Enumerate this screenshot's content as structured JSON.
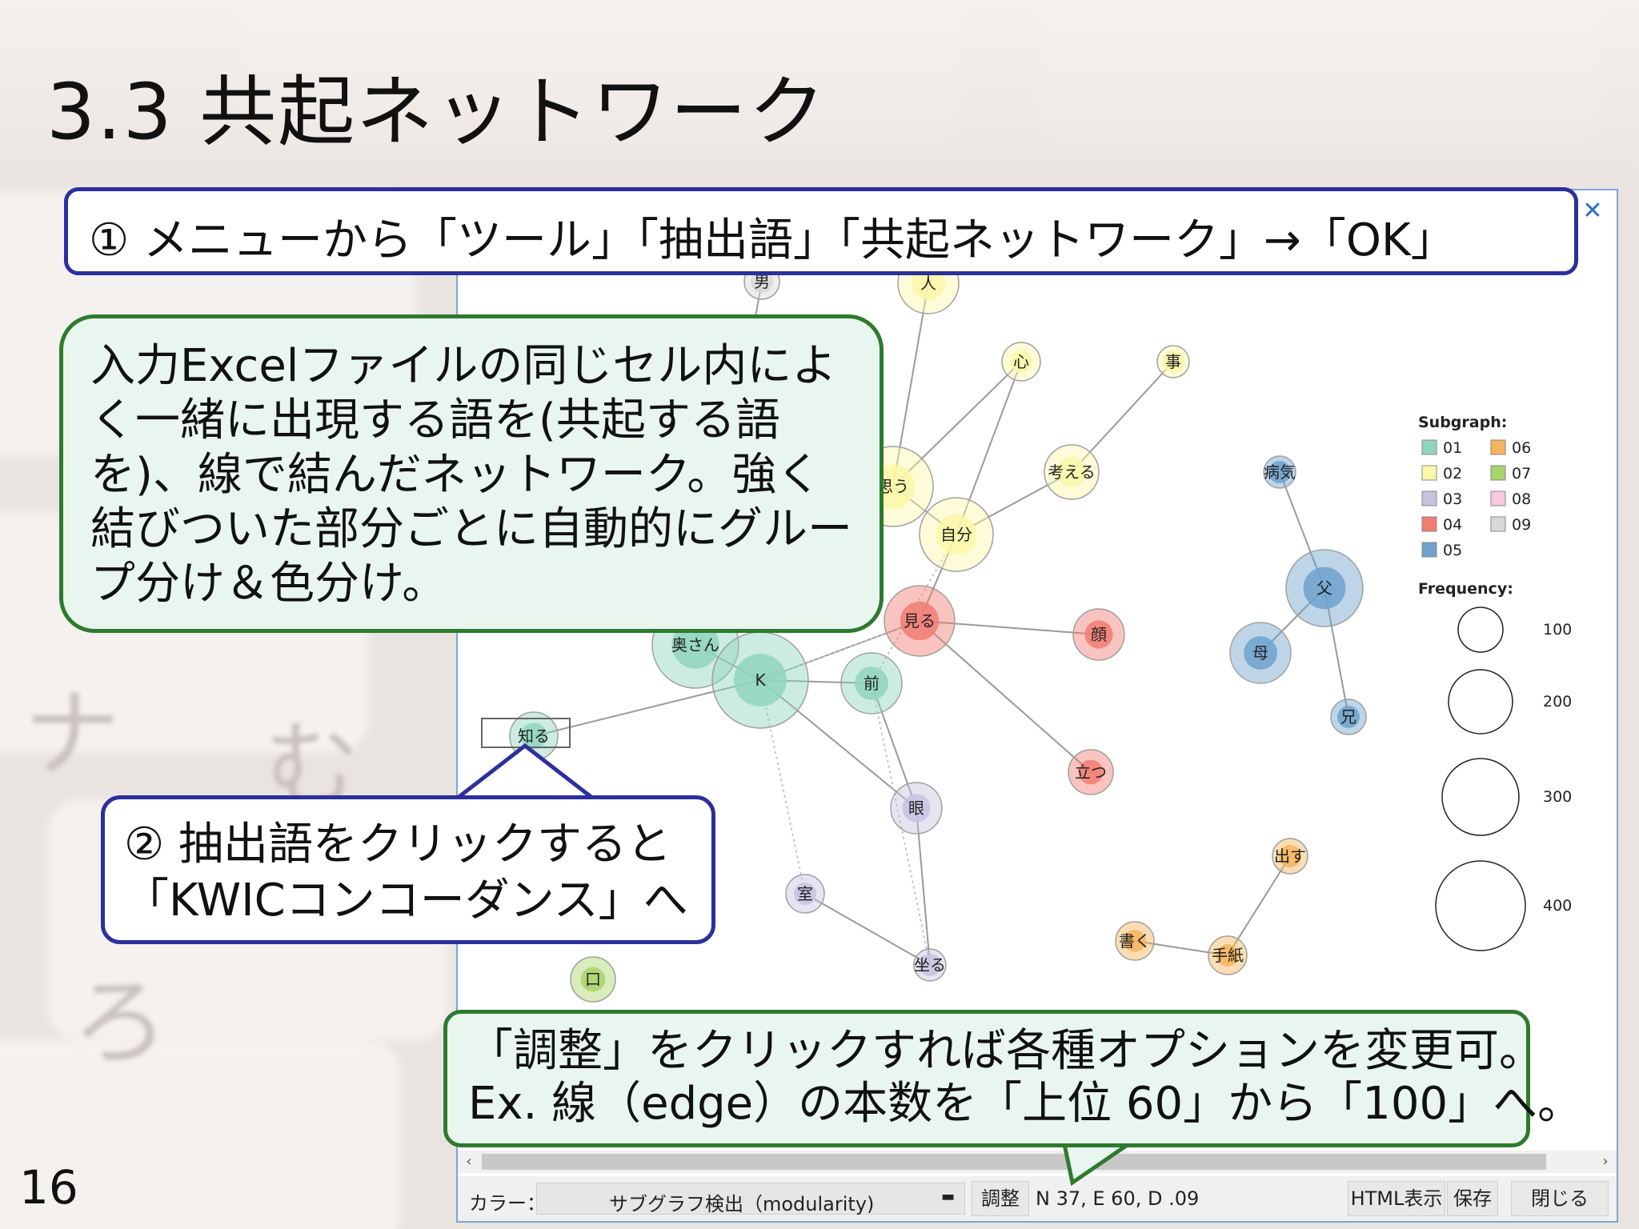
{
  "slide": {
    "title": "3.3 共起ネットワーク",
    "page_number": "16"
  },
  "callouts": {
    "step1": "① メニューから「ツール」「抽出語」「共起ネットワーク」→「OK」",
    "description": "入力Excelファイルの同じセル内によく一緒に出現する語を(共起する語を)、線で結んだネットワーク。強く結びついた部分ごとに自動的にグループ分け＆色分け。",
    "step2": "② 抽出語をクリックすると「KWICコンコーダンス」へ",
    "adjust": "「調整」をクリックすれば各種オプションを変更可。Ex. 線（edge）の本数を「上位 60」から「100」へ。"
  },
  "window": {
    "close_icon": "close-icon"
  },
  "network": {
    "nodes": [
      {
        "id": "男",
        "label": "男",
        "group": "09"
      },
      {
        "id": "人",
        "label": "人",
        "group": "02"
      },
      {
        "id": "心",
        "label": "心",
        "group": "02"
      },
      {
        "id": "事",
        "label": "事",
        "group": "02"
      },
      {
        "id": "思う",
        "label": "思う",
        "group": "02"
      },
      {
        "id": "考える",
        "label": "考える",
        "group": "02"
      },
      {
        "id": "自分",
        "label": "自分",
        "group": "02"
      },
      {
        "id": "見る",
        "label": "見る",
        "group": "04"
      },
      {
        "id": "顔",
        "label": "顔",
        "group": "04"
      },
      {
        "id": "立つ",
        "label": "立つ",
        "group": "04"
      },
      {
        "id": "奥さん",
        "label": "奥さん",
        "group": "01"
      },
      {
        "id": "K",
        "label": "K",
        "group": "01"
      },
      {
        "id": "前",
        "label": "前",
        "group": "01"
      },
      {
        "id": "知る",
        "label": "知る",
        "group": "01"
      },
      {
        "id": "眼",
        "label": "眼",
        "group": "03"
      },
      {
        "id": "室",
        "label": "室",
        "group": "03"
      },
      {
        "id": "坐る",
        "label": "坐る",
        "group": "03"
      },
      {
        "id": "口",
        "label": "口",
        "group": "07"
      },
      {
        "id": "病気",
        "label": "病気",
        "group": "05"
      },
      {
        "id": "父",
        "label": "父",
        "group": "05"
      },
      {
        "id": "母",
        "label": "母",
        "group": "05"
      },
      {
        "id": "兄",
        "label": "兄",
        "group": "05"
      },
      {
        "id": "出す",
        "label": "出す",
        "group": "06"
      },
      {
        "id": "書く",
        "label": "書く",
        "group": "06"
      },
      {
        "id": "手紙",
        "label": "手紙",
        "group": "06"
      }
    ],
    "edges": [
      [
        "人",
        "思う"
      ],
      [
        "心",
        "自分"
      ],
      [
        "心",
        "思う"
      ],
      [
        "事",
        "考える"
      ],
      [
        "考える",
        "自分"
      ],
      [
        "思う",
        "自分"
      ],
      [
        "自分",
        "見る"
      ],
      [
        "見る",
        "顔"
      ],
      [
        "見る",
        "立つ"
      ],
      [
        "見る",
        "K"
      ],
      [
        "奥さん",
        "K"
      ],
      [
        "K",
        "前"
      ],
      [
        "K",
        "知る"
      ],
      [
        "K",
        "眼"
      ],
      [
        "前",
        "眼"
      ],
      [
        "眼",
        "坐る"
      ],
      [
        "室",
        "坐る"
      ],
      [
        "病気",
        "父"
      ],
      [
        "父",
        "母"
      ],
      [
        "父",
        "兄"
      ],
      [
        "出す",
        "手紙"
      ],
      [
        "書く",
        "手紙"
      ],
      [
        "男",
        "奥さん"
      ]
    ],
    "legend": {
      "subgraph_title": "Subgraph:",
      "groups": [
        {
          "code": "01",
          "color": "#8fd5bf"
        },
        {
          "code": "02",
          "color": "#fbf7a8"
        },
        {
          "code": "03",
          "color": "#c7c3e0"
        },
        {
          "code": "04",
          "color": "#f27c72"
        },
        {
          "code": "05",
          "color": "#6ea1cc"
        },
        {
          "code": "06",
          "color": "#f6b45c"
        },
        {
          "code": "07",
          "color": "#a9d46a"
        },
        {
          "code": "08",
          "color": "#f8c9dc"
        },
        {
          "code": "09",
          "color": "#d8d8d8"
        }
      ],
      "frequency_title": "Frequency:",
      "frequencies": [
        "100",
        "200",
        "300",
        "400"
      ]
    }
  },
  "statusbar": {
    "color_label": "カラー：",
    "color_value": "サブグラフ検出（modularity)",
    "adjust_button": "調整",
    "info": "N 37, E 60, D .09",
    "html_button": "HTML表示",
    "save_button": "保存",
    "close_button": "閉じる"
  }
}
